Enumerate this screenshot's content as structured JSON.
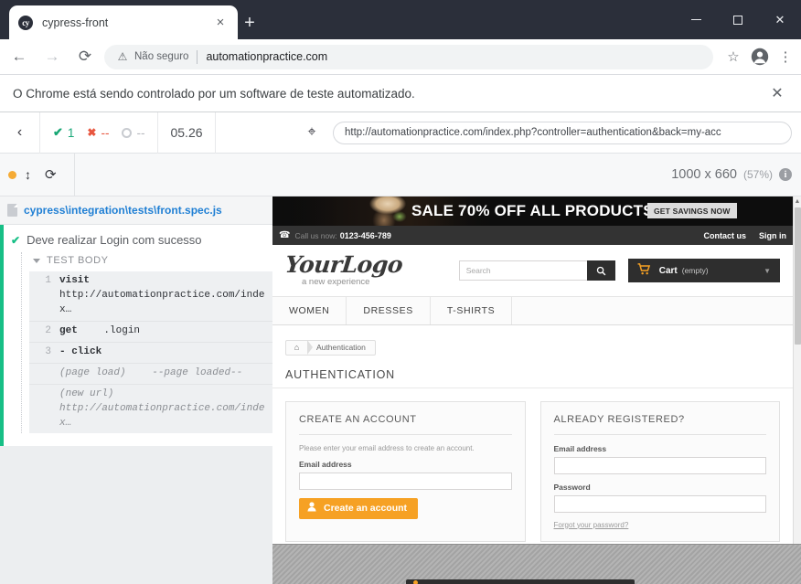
{
  "browser": {
    "tab": {
      "title": "cypress-front",
      "favicon_text": "cy",
      "close_label": "×"
    },
    "new_tab_label": "+",
    "window_controls": {
      "minimize": "—",
      "maximize": "□",
      "close": "✕"
    },
    "nav": {
      "back": "←",
      "forward": "→",
      "reload": "⟳"
    },
    "omnibox": {
      "security_label": "Não seguro",
      "warning_glyph": "⚠",
      "url": "automationpractice.com",
      "star_glyph": "☆",
      "menu_glyph": "⋮"
    },
    "infobar": {
      "message": "O Chrome está sendo controlado por um software de teste automatizado.",
      "close_label": "✕"
    }
  },
  "cypress": {
    "header": {
      "back_glyph": "‹",
      "stats": {
        "passed_glyph": "✔",
        "passed": "1",
        "failed_glyph": "✖",
        "failed": "--",
        "pending": "--"
      },
      "timer": "05.26",
      "selector_playground_glyph": "⌖",
      "url": "http://automationpractice.com/index.php?controller=authentication&back=my-acc"
    },
    "subheader": {
      "viewport_size": "1000 x 660",
      "zoom": "(57%)",
      "info_glyph": "i",
      "updown_glyph": "↕",
      "reload_glyph": "⟳"
    },
    "spec": {
      "path": "cypress\\integration\\tests\\front.spec.js",
      "test_status_glyph": "✔",
      "test_title": "Deve realizar Login com sucesso",
      "section_label": "TEST BODY",
      "commands": [
        {
          "num": "1",
          "name": "visit",
          "arg": "",
          "detail": "http://automationpractice.com/index…",
          "meta": false
        },
        {
          "num": "2",
          "name": "get",
          "arg": ".login",
          "detail": "",
          "meta": false
        },
        {
          "num": "3",
          "name": "- click",
          "arg": "",
          "detail": "",
          "meta": false
        },
        {
          "num": "",
          "name": "(page load)",
          "arg": "--page loaded--",
          "detail": "",
          "meta": true
        },
        {
          "num": "",
          "name": "(new url)",
          "arg": "",
          "detail": "http://automationpractice.com/index…",
          "meta": true
        }
      ]
    }
  },
  "site": {
    "banner": {
      "headline": "SALE 70% OFF ALL PRODUCTS",
      "cta": "GET SAVINGS NOW"
    },
    "topbar": {
      "phone_glyph": "☎",
      "call_label": "Call us now:",
      "phone": "0123-456-789",
      "links": [
        "Contact us",
        "Sign in"
      ]
    },
    "logo": {
      "main": "YourLogo",
      "sub": "a new experience"
    },
    "search": {
      "placeholder": "Search",
      "button_glyph": "⌕"
    },
    "cart": {
      "icon_glyph": "Ὥ2",
      "label": "Cart",
      "status": "(empty)",
      "caret": "▼"
    },
    "menu": [
      "WOMEN",
      "DRESSES",
      "T-SHIRTS"
    ],
    "breadcrumb": {
      "home_glyph": "⌂",
      "current": "Authentication"
    },
    "page_title": "AUTHENTICATION",
    "create_panel": {
      "heading": "CREATE AN ACCOUNT",
      "hint": "Please enter your email address to create an account.",
      "email_label": "Email address",
      "email_value": "",
      "button_label": "Create an account",
      "button_icon": "὆4"
    },
    "login_panel": {
      "heading": "ALREADY REGISTERED?",
      "email_label": "Email address",
      "email_value": "",
      "password_label": "Password",
      "password_value": "",
      "forgot_link": "Forgot your password?"
    }
  },
  "colors": {
    "chrome_titlebar": "#2b2f3a",
    "cypress_pass_green": "#17bf86",
    "cypress_fail_red": "#e8563f",
    "site_orange": "#f6a124",
    "site_dark": "#2e2e2e"
  }
}
